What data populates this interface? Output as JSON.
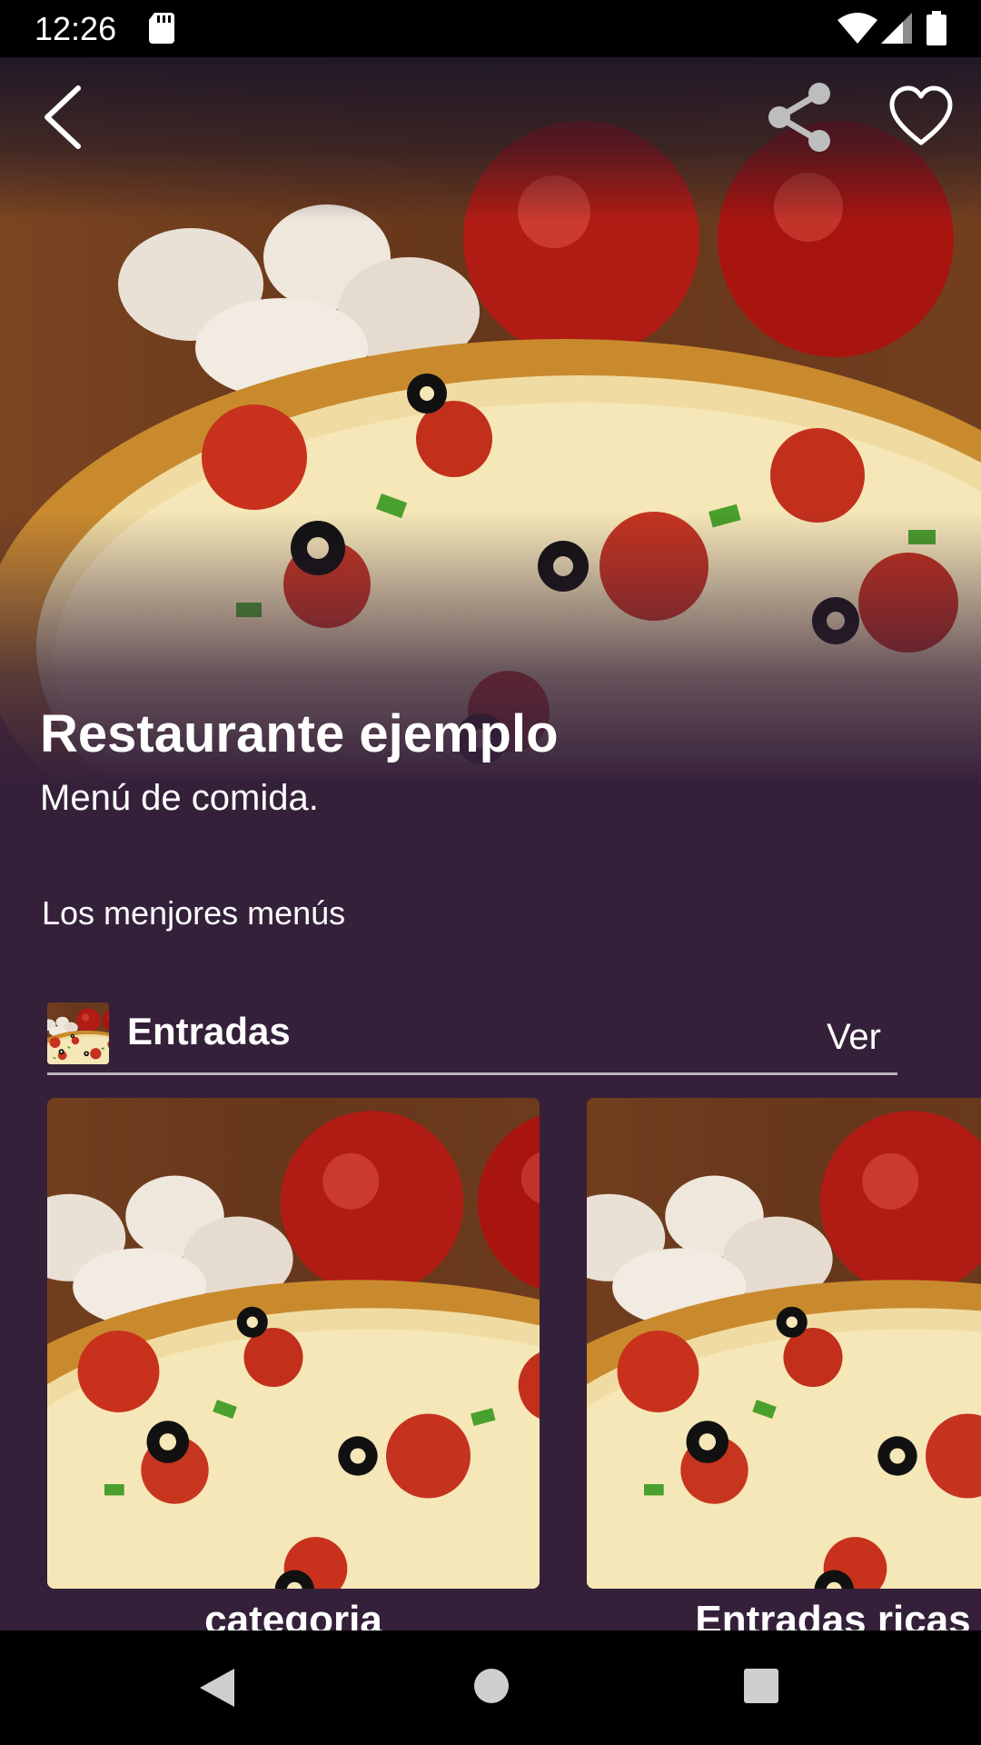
{
  "status_bar": {
    "time": "12:26",
    "icons": [
      "sd-card-icon",
      "wifi-icon",
      "signal-icon",
      "battery-icon"
    ]
  },
  "header": {
    "back_icon": "chevron-left-icon",
    "share_icon": "share-icon",
    "favorite_icon": "heart-icon"
  },
  "restaurant": {
    "name": "Restaurante ejemplo",
    "subtitle": "Menú de comida.",
    "tagline": "Los menjores menús"
  },
  "section": {
    "title": "Entradas",
    "more_label": "Ver",
    "thumb_icon": "pizza-photo"
  },
  "cards": [
    {
      "label": "categoria",
      "image": "pizza-photo"
    },
    {
      "label": "Entradas ricas",
      "image": "pizza-photo"
    }
  ],
  "nav_bar": {
    "icons": [
      "back-triangle-icon",
      "home-circle-icon",
      "recents-square-icon"
    ]
  },
  "colors": {
    "background": "#35203a",
    "text": "#ffffff",
    "divider": "#bdb3c0"
  }
}
